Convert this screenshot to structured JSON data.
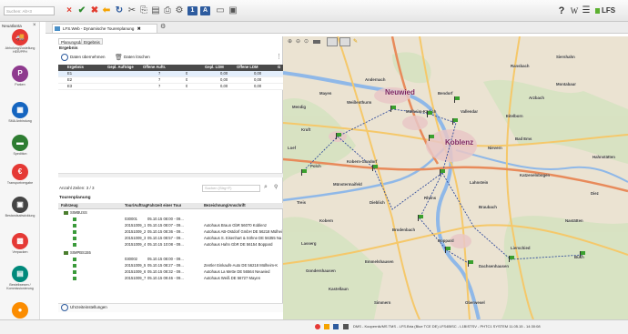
{
  "toolbar": {
    "search_placeholder": "Suchen: Alt+3",
    "sq_buttons": [
      "1",
      "A"
    ],
    "right_help": "?",
    "right_w": "W",
    "brand": "LFS"
  },
  "sidebar": {
    "title": "Neuatlanta",
    "items": [
      {
        "label": "Abholung/Zustellung HER/PPH",
        "icon": "truck-icon",
        "color": "#e53935",
        "glyph": "🚚"
      },
      {
        "label": "Parken",
        "icon": "parking-icon",
        "color": "#8e3a8e",
        "glyph": "P"
      },
      {
        "label": "SMA Anbindung",
        "icon": "calendar-icon",
        "color": "#1565c0",
        "glyph": "▦"
      },
      {
        "label": "Spedition",
        "icon": "truck-icon",
        "color": "#2e7d32",
        "glyph": "▬"
      },
      {
        "label": "Transportvergabe",
        "icon": "euro-icon",
        "color": "#e53935",
        "glyph": "€"
      },
      {
        "label": "Bestandsabwicklung",
        "icon": "box-icon",
        "color": "#444444",
        "glyph": "▣"
      },
      {
        "label": "Verpacken",
        "icon": "package-icon",
        "color": "#e53935",
        "glyph": "▩"
      },
      {
        "label": "Bestellwesen / Kommissionierung",
        "icon": "clipboard-icon",
        "color": "#00897b",
        "glyph": "▤"
      },
      {
        "label": "",
        "icon": "tool-icon",
        "color": "#fb8c00",
        "glyph": "●"
      }
    ]
  },
  "tab": {
    "label": "LFS.Web - Dynamische Tourenplanung"
  },
  "subtabs": [
    "Planungsdaten",
    "Ergebnis"
  ],
  "ergebnis": {
    "title": "Ergebnis",
    "btn_uebernehmen": "Daten übernehmen",
    "btn_loeschen": "Daten löschen",
    "columns": [
      "Ergebnis",
      "Gepl. Aufträge",
      "Offene Auftr.",
      "Gepl. LDM",
      "Offene LDM",
      "G"
    ],
    "rows": [
      [
        "E1",
        "7",
        "0",
        "0,00",
        "0,00"
      ],
      [
        "E2",
        "7",
        "0",
        "0,00",
        "0,00"
      ],
      [
        "E3",
        "7",
        "0",
        "0,00",
        "0,00"
      ]
    ],
    "anzahl": "Anzahl Zeilen: 3 / 3",
    "filter_placeholder": "Suchen (Strg+F)"
  },
  "tour": {
    "title": "Tourenplanung",
    "columns": [
      "Fahrzeug",
      "Tour/Auftrag",
      "Fahrzeit einer Tour",
      "Bezeichnung/Anschrift"
    ],
    "groups": [
      {
        "name": "SIMBUSS",
        "rows": [
          [
            "030001",
            "05.10.15 08:00 - 09...",
            ""
          ],
          [
            "20151009_1",
            "05.10.15 08:07 - 09...",
            "Autohaus Braun GbR 56070 Koblenz"
          ],
          [
            "20151009_2",
            "05.10.15 08:36 - 09...",
            "Autohaus AB-Ostdorf GmbH DE 56218 Mülheim-Kä"
          ],
          [
            "20151009_3",
            "05.10.15 08:57 - 09...",
            "Autohaus S. Eisenhart & Söhne DE 56355 Na"
          ],
          [
            "20151009_4",
            "05.10.15 10:08 - 09...",
            "Autohaus Hahn GbR DE 56154 Boppard"
          ]
        ]
      },
      {
        "name": "SIMPBS155",
        "rows": [
          [
            "030002",
            "05.10.15 08:00 - 09...",
            ""
          ],
          [
            "20151009_5",
            "05.10.15 08:27 - 09...",
            "Zentler Einkaufs-Auto DE 56218 Mülheim-K"
          ],
          [
            "20151009_6",
            "05.10.15 08:32 - 09...",
            "Autohaus La Mette DE 56564 Neuwied"
          ],
          [
            "20151009_7",
            "05.10.15 09:46 - 09...",
            "Autohaus Weiß DE 56727 Mayen"
          ]
        ]
      }
    ],
    "footer": "Uhrzeiteinstellungen"
  },
  "map": {
    "places": [
      {
        "n": "Andernach",
        "big": false
      },
      {
        "n": "Neuwied",
        "big": true
      },
      {
        "n": "Bendorf",
        "big": false
      },
      {
        "n": "Koblenz",
        "big": true
      },
      {
        "n": "Lahnstein",
        "big": false
      },
      {
        "n": "Boppard",
        "big": false
      },
      {
        "n": "Montabaur",
        "big": false
      },
      {
        "n": "Mayen",
        "big": false
      },
      {
        "n": "Vallendar",
        "big": false
      },
      {
        "n": "Polch",
        "big": false
      },
      {
        "n": "Treis",
        "big": false
      },
      {
        "n": "Emmelshausen",
        "big": false
      },
      {
        "n": "Nastätten",
        "big": false
      },
      {
        "n": "Bad Ems",
        "big": false
      },
      {
        "n": "Braubach",
        "big": false
      },
      {
        "n": "Kastellaun",
        "big": false
      },
      {
        "n": "Rhens",
        "big": false
      },
      {
        "n": "Dieblich",
        "big": false
      },
      {
        "n": "Hahnstätten",
        "big": false
      },
      {
        "n": "Diez",
        "big": false
      },
      {
        "n": "Siershahn",
        "big": false
      },
      {
        "n": "Ransbach",
        "big": false
      },
      {
        "n": "Weißenthurm",
        "big": false
      },
      {
        "n": "Mülheim-Kärlich",
        "big": false
      },
      {
        "n": "Kruft",
        "big": false
      },
      {
        "n": "Mendig",
        "big": false
      },
      {
        "n": "Münstermaifeld",
        "big": false
      },
      {
        "n": "Kobern-Gondorf",
        "big": false
      },
      {
        "n": "Brodenbach",
        "big": false
      },
      {
        "n": "Lasserg",
        "big": false
      },
      {
        "n": "Gondershausen",
        "big": false
      },
      {
        "n": "Buch",
        "big": false
      },
      {
        "n": "Katzenelnbogen",
        "big": false
      },
      {
        "n": "Lierschied",
        "big": false
      },
      {
        "n": "Dachsenhausen",
        "big": false
      },
      {
        "n": "Nievern",
        "big": false
      },
      {
        "n": "Eitelborn",
        "big": false
      },
      {
        "n": "Arzbach",
        "big": false
      },
      {
        "n": "Simmern",
        "big": false
      },
      {
        "n": "Kobern",
        "big": false
      },
      {
        "n": "Oberwesel",
        "big": false
      },
      {
        "n": "Loef",
        "big": false
      }
    ]
  },
  "status": {
    "text": "DMS - Koopernik/MS TMS - LFS.Bria (Blue TCE DE) LFS4BISC - L1BISTSV - PHTC1 SYSTEM  11.05.15 - 14:30:08"
  }
}
